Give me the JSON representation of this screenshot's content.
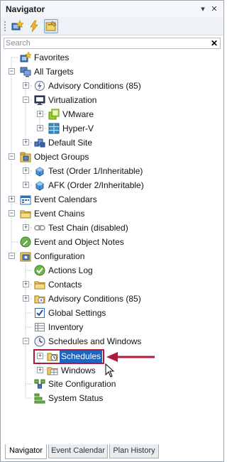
{
  "navigator": {
    "title": "Navigator",
    "pin_glyph": "▾",
    "close_glyph": "✕"
  },
  "toolbar": {
    "buttons": [
      {
        "icon": "favorites-tool-icon"
      },
      {
        "icon": "lightning-icon"
      },
      {
        "icon": "notes-tool-icon"
      }
    ]
  },
  "search": {
    "placeholder": "Search",
    "value": "",
    "clear_glyph": "✕"
  },
  "tree": {
    "items": [
      {
        "label": "Favorites"
      },
      {
        "label": "All Targets"
      },
      {
        "label": "Advisory Conditions (85)"
      },
      {
        "label": "Virtualization"
      },
      {
        "label": "VMware"
      },
      {
        "label": "Hyper-V"
      },
      {
        "label": "Default Site"
      },
      {
        "label": "Object Groups"
      },
      {
        "label": "Test (Order 1/Inheritable)"
      },
      {
        "label": "AFK (Order 2/Inheritable)"
      },
      {
        "label": "Event Calendars"
      },
      {
        "label": "Event Chains"
      },
      {
        "label": "Test Chain (disabled)"
      },
      {
        "label": "Event and Object Notes"
      },
      {
        "label": "Configuration"
      },
      {
        "label": "Actions Log"
      },
      {
        "label": "Contacts"
      },
      {
        "label": "Advisory Conditions (85)"
      },
      {
        "label": "Global Settings"
      },
      {
        "label": "Inventory"
      },
      {
        "label": "Schedules and Windows"
      },
      {
        "label": "Schedules"
      },
      {
        "label": "Windows"
      },
      {
        "label": "Site Configuration"
      },
      {
        "label": "System Status"
      }
    ],
    "expand_minus": "−",
    "expand_plus": "+"
  },
  "tabs": [
    {
      "label": "Navigator",
      "active": true
    },
    {
      "label": "Event Calendar",
      "active": false
    },
    {
      "label": "Plan History",
      "active": false
    }
  ],
  "colors": {
    "selection": "#1f66c1",
    "highlight_border": "#b0183c",
    "arrow": "#b0183c"
  }
}
